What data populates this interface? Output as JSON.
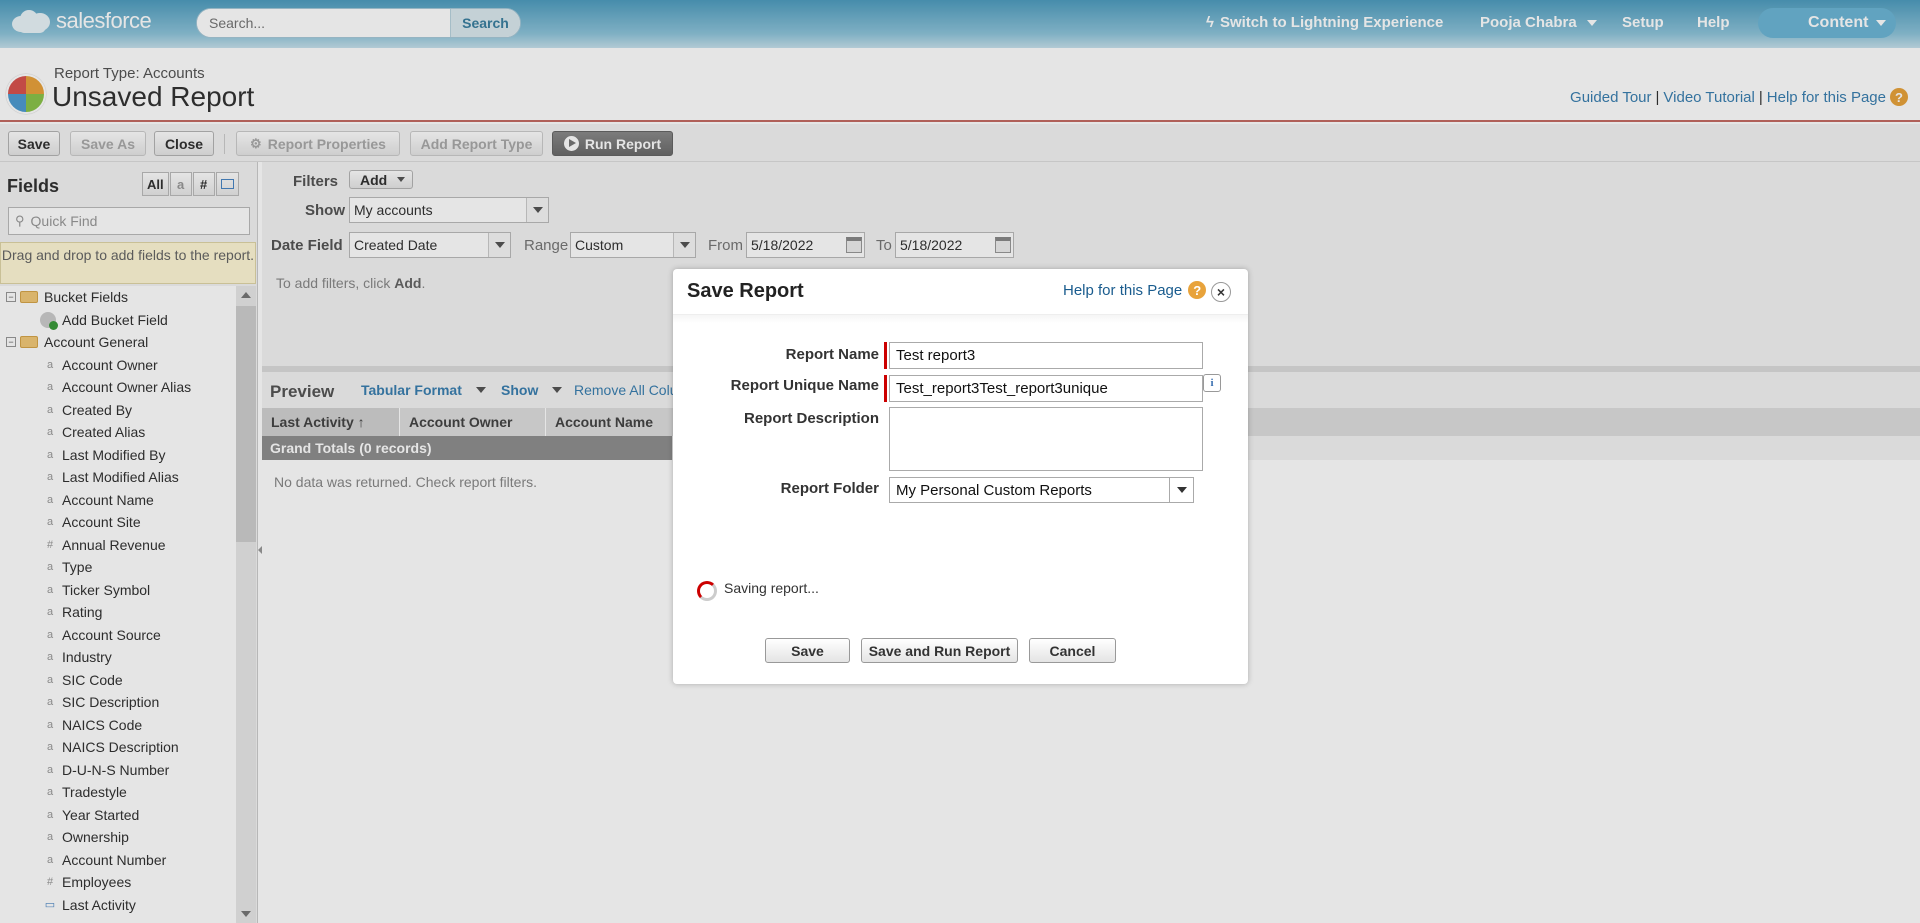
{
  "header": {
    "logo_text": "salesforce",
    "search_placeholder": "Search...",
    "search_button": "Search",
    "lightning_link": "Switch to Lightning Experience",
    "user_name": "Pooja Chabra",
    "setup": "Setup",
    "help": "Help",
    "app_menu": "Content"
  },
  "title": {
    "report_type": "Report Type: Accounts",
    "report_name": "Unsaved Report",
    "guided_tour": "Guided Tour",
    "video_tutorial": "Video Tutorial",
    "help_page": "Help for this Page",
    "separator": "|"
  },
  "toolbar": {
    "save": "Save",
    "save_as": "Save As",
    "close": "Close",
    "report_properties": "Report Properties",
    "add_report_type": "Add Report Type",
    "run_report": "Run Report"
  },
  "fields_pane": {
    "title": "Fields",
    "filter_all": "All",
    "filter_text": "a",
    "filter_number": "#",
    "quick_find_placeholder": "Quick Find",
    "drag_hint": "Drag and drop to add fields to the report.",
    "folders": [
      {
        "label": "Bucket Fields",
        "toggle": "⊖"
      },
      {
        "label": "Account General",
        "toggle": "⊖"
      }
    ],
    "add_bucket_field": "Add Bucket Field",
    "fields": [
      {
        "label": "Account Owner",
        "icon": "a"
      },
      {
        "label": "Account Owner Alias",
        "icon": "a"
      },
      {
        "label": "Created By",
        "icon": "a"
      },
      {
        "label": "Created Alias",
        "icon": "a"
      },
      {
        "label": "Last Modified By",
        "icon": "a"
      },
      {
        "label": "Last Modified Alias",
        "icon": "a"
      },
      {
        "label": "Account Name",
        "icon": "a"
      },
      {
        "label": "Account Site",
        "icon": "a"
      },
      {
        "label": "Annual Revenue",
        "icon": "#"
      },
      {
        "label": "Type",
        "icon": "a"
      },
      {
        "label": "Ticker Symbol",
        "icon": "a"
      },
      {
        "label": "Rating",
        "icon": "a"
      },
      {
        "label": "Account Source",
        "icon": "a"
      },
      {
        "label": "Industry",
        "icon": "a"
      },
      {
        "label": "SIC Code",
        "icon": "a"
      },
      {
        "label": "SIC Description",
        "icon": "a"
      },
      {
        "label": "NAICS Code",
        "icon": "a"
      },
      {
        "label": "NAICS Description",
        "icon": "a"
      },
      {
        "label": "D-U-N-S Number",
        "icon": "a"
      },
      {
        "label": "Tradestyle",
        "icon": "a"
      },
      {
        "label": "Year Started",
        "icon": "a"
      },
      {
        "label": "Ownership",
        "icon": "a"
      },
      {
        "label": "Account Number",
        "icon": "a"
      },
      {
        "label": "Employees",
        "icon": "#"
      },
      {
        "label": "Last Activity",
        "icon": "▭"
      }
    ]
  },
  "filters": {
    "label": "Filters",
    "add": "Add",
    "show_label": "Show",
    "show_value": "My accounts",
    "date_field_label": "Date Field",
    "date_field_value": "Created Date",
    "range_label": "Range",
    "range_value": "Custom",
    "from_label": "From",
    "from_value": "5/18/2022",
    "to_label": "To",
    "to_value": "5/18/2022",
    "hint_prefix": "To add filters, click",
    "hint_action": "Add",
    "hint_suffix": "."
  },
  "preview": {
    "title": "Preview",
    "format": "Tabular Format",
    "show": "Show",
    "remove_all": "Remove All Colu",
    "columns": [
      "Last Activity ↑",
      "Account Owner",
      "Account Name"
    ],
    "grand_totals": "Grand Totals (0 records)",
    "no_data": "No data was returned. Check report filters."
  },
  "modal": {
    "title": "Save Report",
    "help": "Help for this Page",
    "close_glyph": "×",
    "report_name_label": "Report Name",
    "report_name_value": "Test report3",
    "unique_name_label": "Report Unique Name",
    "unique_name_value": "Test_report3Test_report3unique",
    "info_glyph": "i",
    "description_label": "Report Description",
    "description_value": "",
    "folder_label": "Report Folder",
    "folder_value": "My Personal Custom Reports",
    "status": "Saving report...",
    "save": "Save",
    "save_and_run": "Save and Run Report",
    "cancel": "Cancel"
  }
}
